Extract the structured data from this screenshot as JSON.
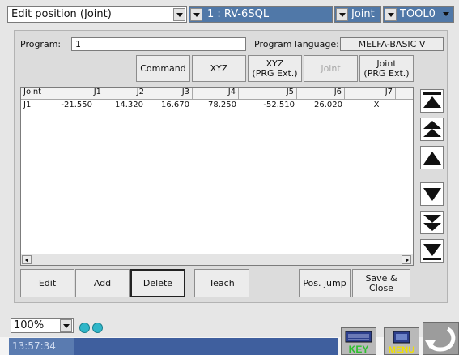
{
  "topbar": {
    "mode": "Edit position (Joint)",
    "robot": "1 : RV-6SQL",
    "coord": "Joint",
    "tool": "TOOL0"
  },
  "program": {
    "label": "Program:",
    "value": "1",
    "language_label": "Program language:",
    "language_value": "MELFA-BASIC V"
  },
  "view_buttons": {
    "command": "Command",
    "xyz": "XYZ",
    "xyz_ext_1": "XYZ",
    "xyz_ext_2": "(PRG Ext.)",
    "joint": "Joint",
    "joint_ext_1": "Joint",
    "joint_ext_2": "(PRG Ext.)"
  },
  "table": {
    "headers": [
      "Joint",
      "J1",
      "J2",
      "J3",
      "J4",
      "J5",
      "J6",
      "J7"
    ],
    "rows": [
      [
        "J1",
        "-21.550",
        "14.320",
        "16.670",
        "78.250",
        "-52.510",
        "26.020",
        "X"
      ]
    ]
  },
  "actions": {
    "edit": "Edit",
    "add": "Add",
    "delete": "Delete",
    "teach": "Teach",
    "pos_jump": "Pos. jump",
    "save_close": "Save & Close"
  },
  "status": {
    "zoom": "100%",
    "time": "13:57:34"
  },
  "buttons_bottom": {
    "key": "KEY",
    "menu": "MENU"
  },
  "colors": {
    "accent_blue": "#3f5f9e",
    "indicator": "#30b6c8",
    "key_green": "#2ec02e",
    "menu_yellow": "#f0e000"
  }
}
